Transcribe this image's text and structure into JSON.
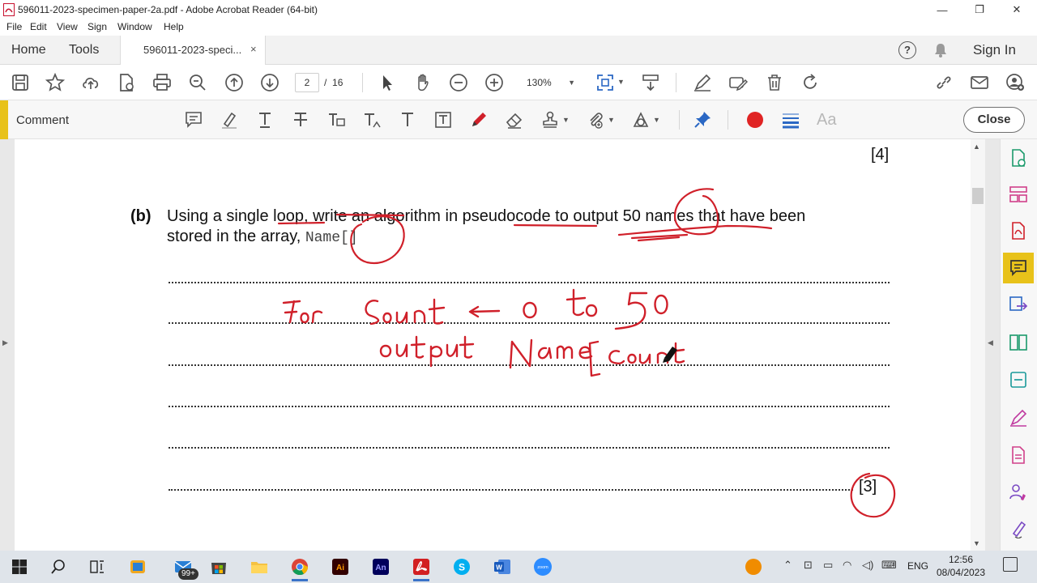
{
  "window": {
    "title": "596011-2023-specimen-paper-2a.pdf - Adobe Acrobat Reader (64-bit)",
    "minimize": "—",
    "restore": "❐",
    "close": "✕"
  },
  "menu": [
    "File",
    "Edit",
    "View",
    "Sign",
    "Window",
    "Help"
  ],
  "tabs": {
    "home": "Home",
    "tools": "Tools",
    "document": "596011-2023-speci...",
    "close": "×",
    "help": "?",
    "sign_in": "Sign In"
  },
  "toolbar": {
    "page_current": "2",
    "page_separator": "/",
    "page_total": "16",
    "zoom": "130%",
    "icons": [
      "save-icon",
      "bookmark-star-icon",
      "upload-icon",
      "create-pdf-icon",
      "print-icon",
      "search-zoom-icon",
      "page-up-icon",
      "page-down-icon",
      "select-cursor-icon",
      "hand-icon",
      "zoom-out-icon",
      "zoom-in-icon",
      "fit-page-icon",
      "scroll-mode-icon",
      "fill-sign-icon",
      "edit-pdf-icon",
      "delete-icon",
      "rotate-icon",
      "share-link-icon",
      "email-icon",
      "user-add-icon"
    ]
  },
  "comment_toolbar": {
    "label": "Comment",
    "close_label": "Close",
    "active_color": "#e02424",
    "accent_color": "#e8c21a",
    "font_label": "Aa"
  },
  "document": {
    "marks_top": "[4]",
    "question_label": "(b)",
    "question_line1": "Using a single loop, write an algorithm in pseudocode to output 50 names that have been",
    "question_line2_prefix": "stored in the array,",
    "question_code": "Name[]",
    "marks_bottom": "[3]",
    "annotation_color": "#d0202a",
    "handwriting": {
      "line1": [
        "For",
        "Count",
        "←",
        "0",
        "to",
        "50"
      ],
      "line2": [
        "output",
        "Name",
        "[Count"
      ]
    }
  },
  "taskbar": {
    "mail_badge": "99+",
    "language": "ENG",
    "time": "12:56",
    "date": "08/04/2023",
    "apps": [
      "windows-start-icon",
      "search-icon",
      "task-view-icon",
      "widgets-icon",
      "mail-icon",
      "store-icon",
      "file-explorer-icon",
      "chrome-icon",
      "illustrator-icon",
      "animate-icon",
      "acrobat-icon",
      "skype-icon",
      "word-icon",
      "zoom-icon"
    ]
  }
}
